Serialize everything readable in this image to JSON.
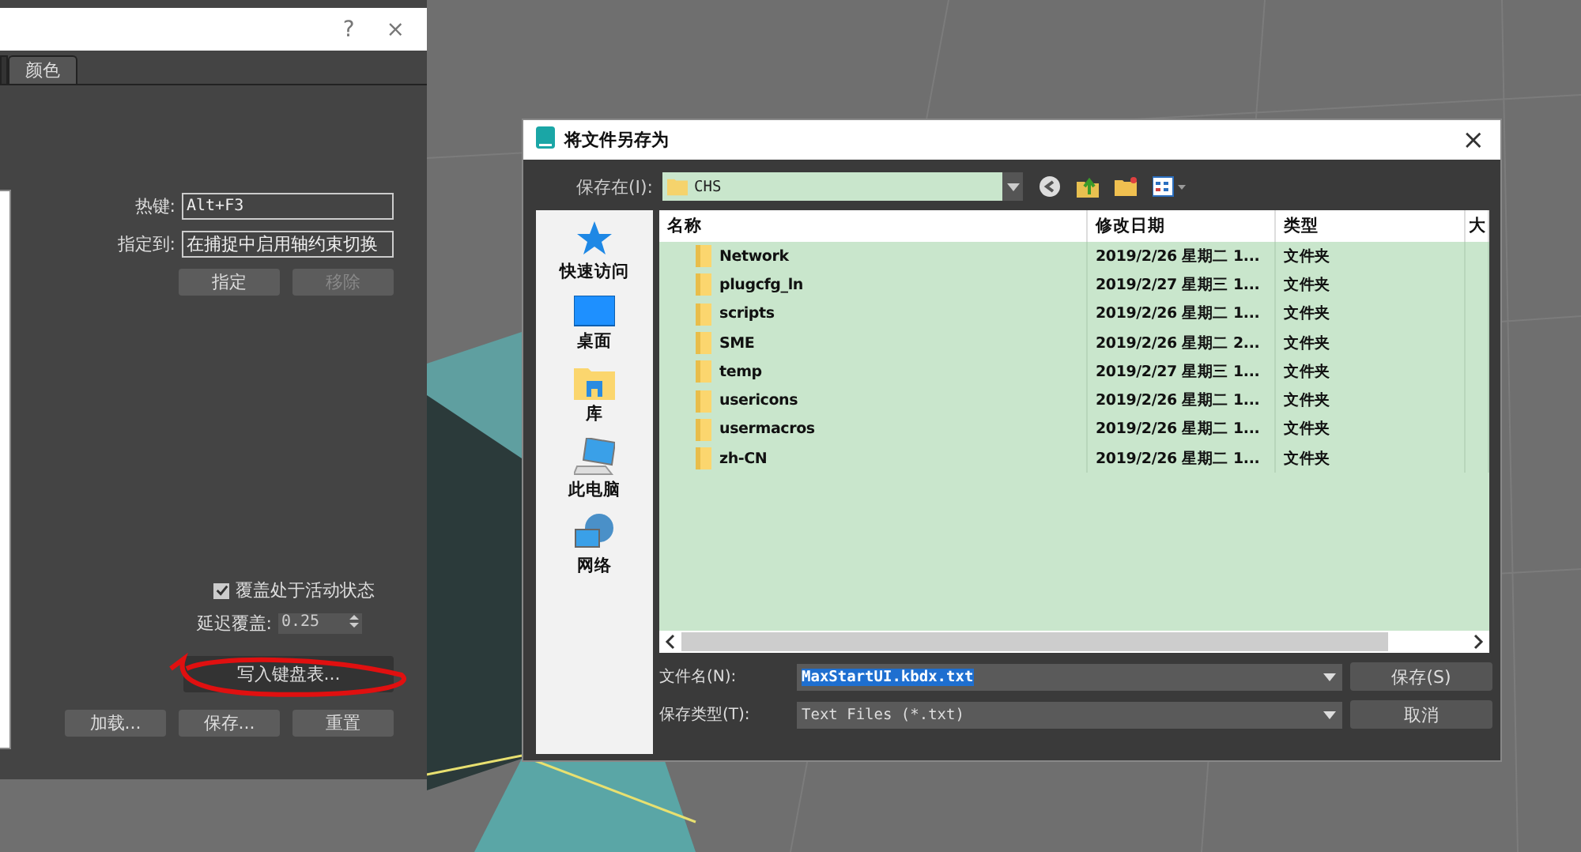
{
  "hotkey_dialog": {
    "help": "?",
    "close": "×",
    "tabs": [
      {
        "label": "颜色",
        "selected": true
      }
    ],
    "hotkey": {
      "label": "热键:",
      "value": "Alt+F3"
    },
    "assigned": {
      "label": "指定到:",
      "value": "在捕捉中启用轴约束切换"
    },
    "assign_buttons": [
      {
        "label": "指定",
        "disabled": false
      },
      {
        "label": "移除",
        "disabled": true
      }
    ],
    "override": {
      "label": "覆盖处于活动状态",
      "checked": true
    },
    "delay": {
      "label": "延迟覆盖:",
      "value": "0.25"
    },
    "write_button": {
      "label": "写入键盘表...",
      "circled": true
    },
    "bottom_buttons": [
      "加载...",
      "保存...",
      "重置"
    ]
  },
  "save_dialog": {
    "title": "将文件另存为",
    "close": "×",
    "save_in": {
      "label": "保存在(I):",
      "value": "CHS"
    },
    "places": [
      {
        "label": "快速访问",
        "kind": "star"
      },
      {
        "label": "桌面",
        "kind": "desktop"
      },
      {
        "label": "库",
        "kind": "library"
      },
      {
        "label": "此电脑",
        "kind": "computer"
      },
      {
        "label": "网络",
        "kind": "network"
      }
    ],
    "columns": [
      "名称",
      "修改日期",
      "类型",
      "大"
    ],
    "rows": [
      {
        "name": "Network",
        "date": "2019/2/26 星期二 1...",
        "type": "文件夹"
      },
      {
        "name": "plugcfg_ln",
        "date": "2019/2/27 星期三 1...",
        "type": "文件夹"
      },
      {
        "name": "scripts",
        "date": "2019/2/26 星期二 1...",
        "type": "文件夹"
      },
      {
        "name": "SME",
        "date": "2019/2/26 星期二 2...",
        "type": "文件夹"
      },
      {
        "name": "temp",
        "date": "2019/2/27 星期三 1...",
        "type": "文件夹"
      },
      {
        "name": "usericons",
        "date": "2019/2/26 星期二 1...",
        "type": "文件夹"
      },
      {
        "name": "usermacros",
        "date": "2019/2/26 星期二 1...",
        "type": "文件夹"
      },
      {
        "name": "zh-CN",
        "date": "2019/2/26 星期二 1...",
        "type": "文件夹"
      }
    ],
    "file_name": {
      "label": "文件名(N):",
      "value": "MaxStartUI.kbdx.txt"
    },
    "file_type": {
      "label": "保存类型(T):",
      "value": "Text Files (*.txt)"
    },
    "save_button": "保存(S)",
    "cancel_button": "取消"
  }
}
